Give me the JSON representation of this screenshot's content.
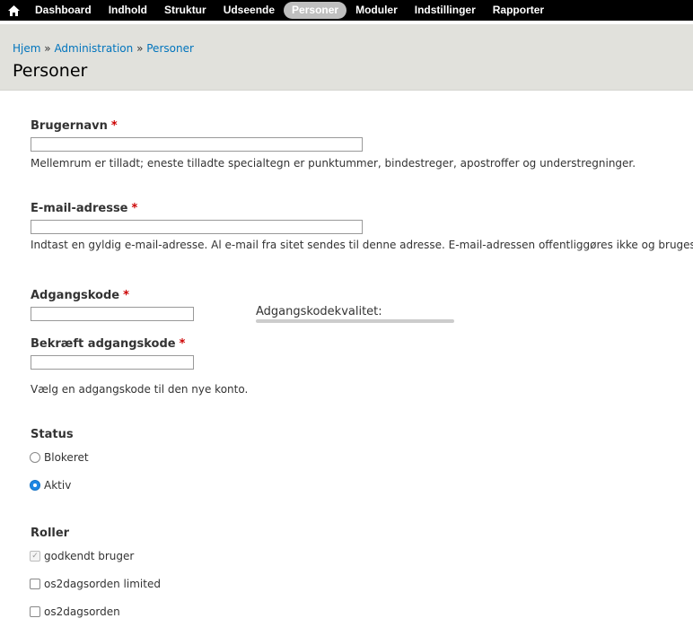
{
  "toolbar": {
    "home_icon": "home-icon",
    "items": [
      {
        "label": "Dashboard",
        "active": false
      },
      {
        "label": "Indhold",
        "active": false
      },
      {
        "label": "Struktur",
        "active": false
      },
      {
        "label": "Udseende",
        "active": false
      },
      {
        "label": "Personer",
        "active": true
      },
      {
        "label": "Moduler",
        "active": false
      },
      {
        "label": "Indstillinger",
        "active": false
      },
      {
        "label": "Rapporter",
        "active": false
      }
    ]
  },
  "breadcrumb": {
    "items": [
      "Hjem",
      "Administration",
      "Personer"
    ],
    "separator": "»"
  },
  "page_title": "Personer",
  "form": {
    "username": {
      "label": "Brugernavn",
      "required_marker": "*",
      "value": "",
      "description": "Mellemrum er tilladt; eneste tilladte specialtegn er punktummer, bindestreger, apostroffer og understregninger."
    },
    "email": {
      "label": "E-mail-adresse",
      "required_marker": "*",
      "value": "",
      "description": "Indtast en gyldig e-mail-adresse. Al e-mail fra sitet sendes til denne adresse. E-mail-adressen offentliggøres ikke og bruges k"
    },
    "password": {
      "label": "Adgangskode",
      "required_marker": "*",
      "value": "",
      "strength_label": "Adgangskodekvalitet:"
    },
    "password_confirm": {
      "label": "Bekræft adgangskode",
      "required_marker": "*",
      "value": "",
      "description": "Vælg en adgangskode til den nye konto."
    },
    "status": {
      "label": "Status",
      "options": [
        {
          "label": "Blokeret",
          "checked": false
        },
        {
          "label": "Aktiv",
          "checked": true
        }
      ]
    },
    "roles": {
      "label": "Roller",
      "options": [
        {
          "label": "godkendt bruger",
          "checked": true,
          "disabled": true
        },
        {
          "label": "os2dagsorden limited",
          "checked": false,
          "disabled": false
        },
        {
          "label": "os2dagsorden",
          "checked": false,
          "disabled": false
        }
      ]
    }
  },
  "colors": {
    "toolbar_bg": "#000000",
    "header_bg": "#e1e1dc",
    "link": "#0074bd",
    "required": "#cc0000",
    "radio_checked": "#1e88e5"
  }
}
